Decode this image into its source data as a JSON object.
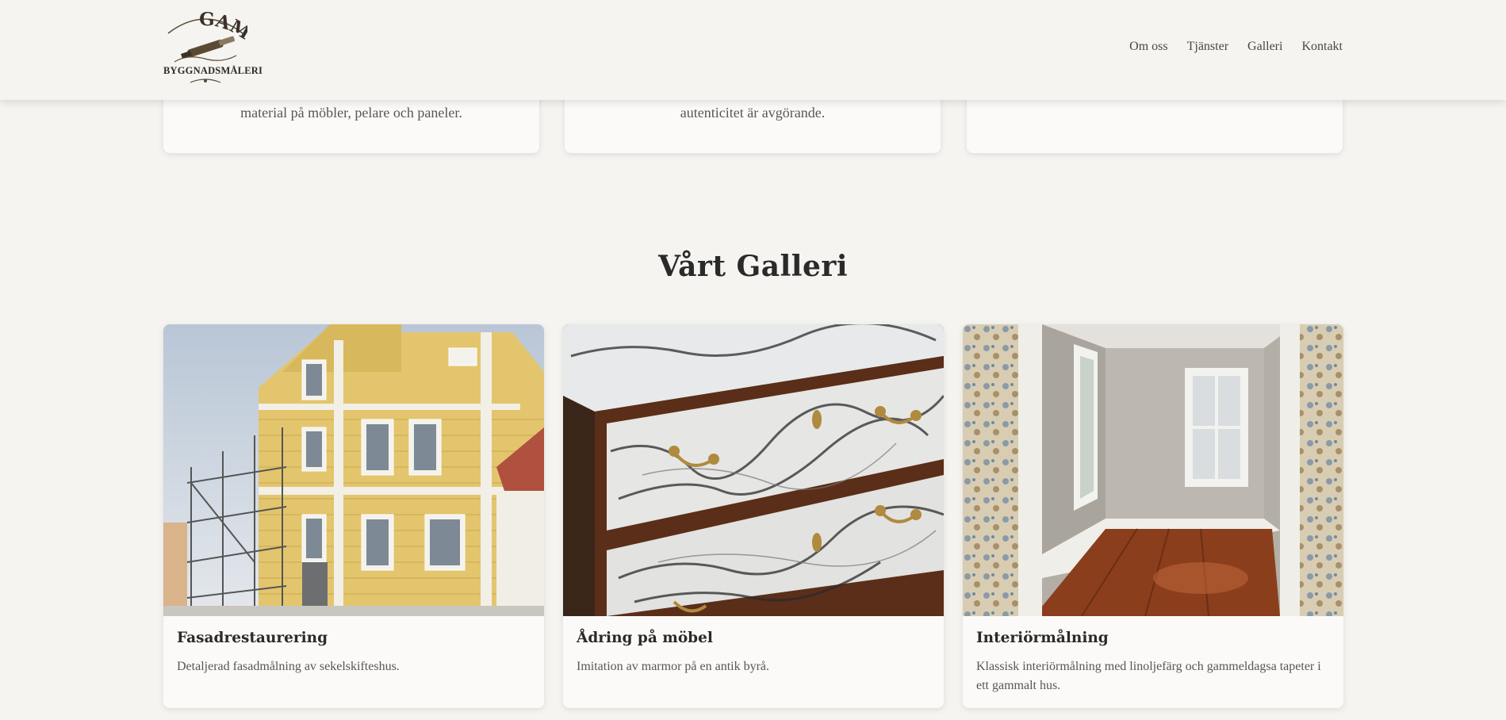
{
  "brand": {
    "logo_top": "GAMMEL",
    "logo_bottom": "BYGGNADSMÅLERI",
    "accent": "#5a4a34"
  },
  "nav": {
    "items": [
      {
        "label": "Om oss"
      },
      {
        "label": "Tjänster"
      },
      {
        "label": "Galleri"
      },
      {
        "label": "Kontakt"
      }
    ]
  },
  "services": {
    "cards": [
      {
        "text": "material på möbler, pelare och paneler."
      },
      {
        "text": "autenticitet är avgörande."
      },
      {
        "text": ""
      }
    ]
  },
  "gallery": {
    "title": "Vårt Galleri",
    "items": [
      {
        "title": "Fasadrestaurering",
        "desc": "Detaljerad fasadmålning av sekelskifteshus.",
        "image": "yellow-facade-with-scaffolding"
      },
      {
        "title": "Ådring på möbel",
        "desc": "Imitation av marmor på en antik byrå.",
        "image": "marble-painted-dresser"
      },
      {
        "title": "Interiörmålning",
        "desc": "Klassisk interiörmålning med linoljefärg och gammeldagsa tapeter i ett gammalt hus.",
        "image": "painted-room-with-wallpaper"
      }
    ]
  }
}
